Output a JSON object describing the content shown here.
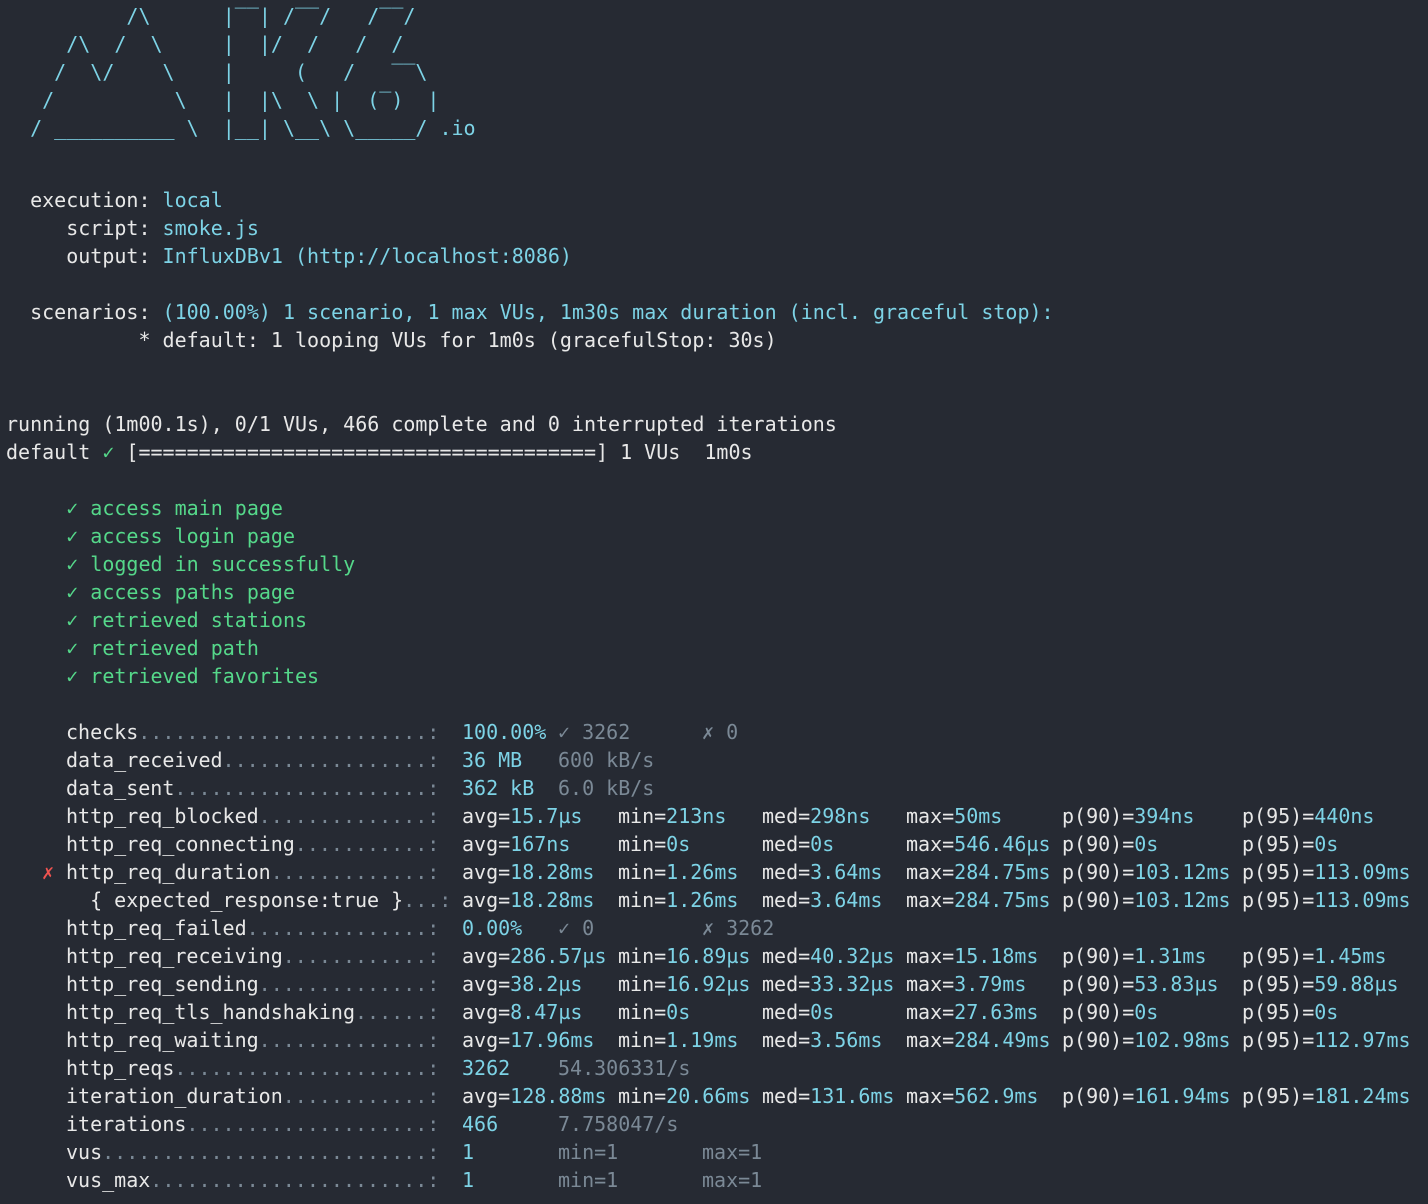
{
  "logo": {
    "art": "          /\\      |‾‾| /‾‾/   /‾‾/\n     /\\  /  \\     |  |/  /   /  /\n    /  \\/    \\    |     (   /   ‾‾\\\n   /          \\   |  |\\  \\ |  (‾)  |\n  / __________ \\  |__| \\__\\ \\_____/",
    "suffix": " .io"
  },
  "config": {
    "execution_label": "  execution: ",
    "execution_value": "local",
    "script_label": "     script: ",
    "script_value": "smoke.js",
    "output_label": "     output: ",
    "output_value": "InfluxDBv1 (http://localhost:8086)",
    "scenarios_label": "  scenarios: ",
    "scenarios_value": "(100.00%) 1 scenario, 1 max VUs, 1m30s max duration (incl. graceful stop):",
    "scenario_default": "           * default: 1 looping VUs for 1m0s (gracefulStop: 30s)"
  },
  "progress": {
    "running": "running (1m00.1s), 0/1 VUs, 466 complete and 0 interrupted iterations",
    "name": "default ",
    "check": "✓",
    "bar": " [======================================] 1 VUs  1m0s"
  },
  "checks": [
    "access main page",
    "access login page",
    "logged in successfully",
    "access paths page",
    "retrieved stations",
    "retrieved path",
    "retrieved favorites"
  ],
  "check_mark": "✓",
  "fail_mark": "✗",
  "metrics": [
    {
      "name": "checks",
      "dots": "........................:",
      "c1": "100.00%",
      "c2": "✓ 3262",
      "c3": "✗ 0"
    },
    {
      "name": "data_received",
      "dots": ".................:",
      "c1": "36 MB",
      "c2": "600 kB/s"
    },
    {
      "name": "data_sent",
      "dots": ".....................:",
      "c1": "362 kB",
      "c2": "6.0 kB/s"
    },
    {
      "name": "http_req_blocked",
      "dots": "..............:",
      "avg": "15.7µs",
      "min": "213ns",
      "med": "298ns",
      "max": "50ms",
      "p90": "394ns",
      "p95": "440ns"
    },
    {
      "name": "http_req_connecting",
      "dots": "...........:",
      "avg": "167ns",
      "min": "0s",
      "med": "0s",
      "max": "546.46µs",
      "p90": "0s",
      "p95": "0s"
    },
    {
      "name": "http_req_duration",
      "dots": ".............:",
      "failed": true,
      "avg": "18.28ms",
      "min": "1.26ms",
      "med": "3.64ms",
      "max": "284.75ms",
      "p90": "103.12ms",
      "p95": "113.09ms"
    },
    {
      "name": "  { expected_response:true }",
      "dots": "...:",
      "avg": "18.28ms",
      "min": "1.26ms",
      "med": "3.64ms",
      "max": "284.75ms",
      "p90": "103.12ms",
      "p95": "113.09ms"
    },
    {
      "name": "http_req_failed",
      "dots": "...............:",
      "c1": "0.00%",
      "c2": "✓ 0",
      "c3": "✗ 3262"
    },
    {
      "name": "http_req_receiving",
      "dots": "............:",
      "avg": "286.57µs",
      "min": "16.89µs",
      "med": "40.32µs",
      "max": "15.18ms",
      "p90": "1.31ms",
      "p95": "1.45ms"
    },
    {
      "name": "http_req_sending",
      "dots": "..............:",
      "avg": "38.2µs",
      "min": "16.92µs",
      "med": "33.32µs",
      "max": "3.79ms",
      "p90": "53.83µs",
      "p95": "59.88µs"
    },
    {
      "name": "http_req_tls_handshaking",
      "dots": "......:",
      "avg": "8.47µs",
      "min": "0s",
      "med": "0s",
      "max": "27.63ms",
      "p90": "0s",
      "p95": "0s"
    },
    {
      "name": "http_req_waiting",
      "dots": "..............:",
      "avg": "17.96ms",
      "min": "1.19ms",
      "med": "3.56ms",
      "max": "284.49ms",
      "p90": "102.98ms",
      "p95": "112.97ms"
    },
    {
      "name": "http_reqs",
      "dots": ".....................:",
      "c1": "3262",
      "c2": "54.306331/s"
    },
    {
      "name": "iteration_duration",
      "dots": "............:",
      "avg": "128.88ms",
      "min": "20.66ms",
      "med": "131.6ms",
      "max": "562.9ms",
      "p90": "161.94ms",
      "p95": "181.24ms"
    },
    {
      "name": "iterations",
      "dots": "....................:",
      "c1": "466",
      "c2": "7.758047/s"
    },
    {
      "name": "vus",
      "dots": "...........................:",
      "c1": "1",
      "c2": "min=1",
      "c3": "max=1"
    },
    {
      "name": "vus_max",
      "dots": ".......................:",
      "c1": "1",
      "c2": "min=1",
      "c3": "max=1"
    }
  ],
  "stat_labels": {
    "avg": "avg=",
    "min": "min=",
    "med": "med=",
    "max": "max=",
    "p90": "p(90)=",
    "p95": "p(95)="
  },
  "colors": {
    "background": "#262a33",
    "cyan": "#7dd3e6",
    "green": "#55d88a",
    "red": "#ef5350",
    "dim": "#7b8996"
  }
}
